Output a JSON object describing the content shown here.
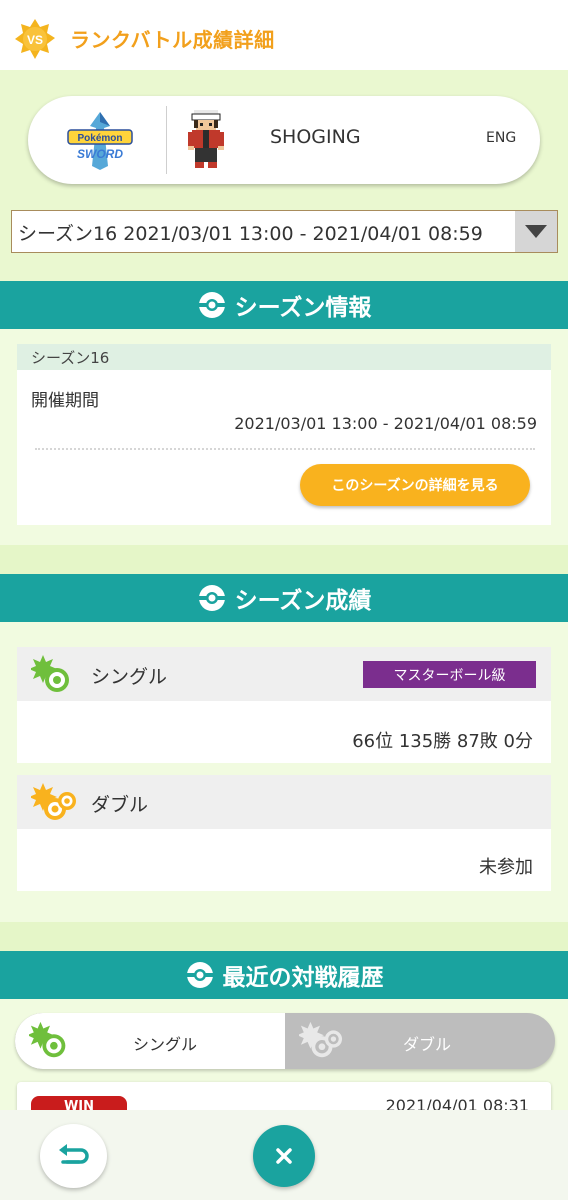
{
  "header": {
    "badge": "VS",
    "title": "ランクバトル成績詳細"
  },
  "profile": {
    "game_logo_text_top": "Pokémon",
    "game_logo_text_bottom": "SWORD",
    "player_name": "SHOGING",
    "language": "ENG"
  },
  "season_select": {
    "value": "シーズン16 2021/03/01 13:00 - 2021/04/01 08:59"
  },
  "season_info": {
    "section_title": "シーズン情報",
    "season_name": "シーズン16",
    "period_label": "開催期間",
    "period_value": "2021/03/01 13:00 - 2021/04/01 08:59",
    "detail_button": "このシーズンの詳細を見る"
  },
  "season_results": {
    "section_title": "シーズン成績",
    "single": {
      "label": "シングル",
      "rank": "マスターボール級",
      "record": "66位 135勝 87敗 0分"
    },
    "double": {
      "label": "ダブル",
      "record": "未参加"
    }
  },
  "history": {
    "section_title": "最近の対戦履歴",
    "tabs": [
      "シングル",
      "ダブル"
    ],
    "active_tab": 0,
    "entries": [
      {
        "result": "WIN",
        "date": "2021/04/01 08:31"
      }
    ]
  },
  "colors": {
    "teal": "#1aa39f",
    "orange": "#f9b21e",
    "purple_rank": "#7b2e8e",
    "win_red": "#c91c1c"
  },
  "icons": {
    "header": "vs-badge-icon",
    "section": "monster-ball-icon",
    "single": "single-battle-icon",
    "double": "double-battle-icon",
    "back": "back-arrow-icon",
    "close": "close-icon"
  }
}
